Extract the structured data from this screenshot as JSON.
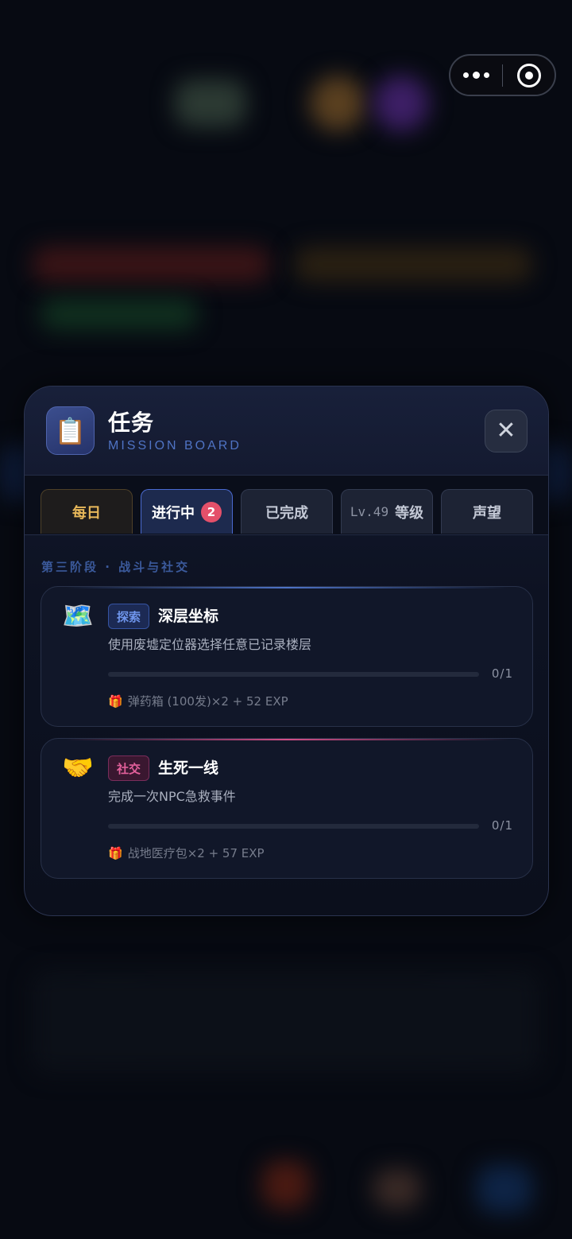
{
  "capsule": {
    "more_icon": "more-dots-icon",
    "close_icon": "target-close-icon"
  },
  "header": {
    "icon": "📋",
    "title": "任务",
    "subtitle": "MISSION BOARD",
    "close_symbol": "✕"
  },
  "tabs": [
    {
      "label": "每日"
    },
    {
      "label": "进行中",
      "badge": "2"
    },
    {
      "label": "已完成"
    },
    {
      "level_prefix": "Lv.49",
      "label": "等级"
    },
    {
      "label": "声望"
    }
  ],
  "stage_label": "第三阶段 · 战斗与社交",
  "missions": [
    {
      "icon": "🗺️",
      "tag": "探索",
      "title": "深层坐标",
      "description": "使用废墟定位器选择任意已记录楼层",
      "progress_text": "0/1",
      "progress_fraction": 0,
      "reward_icon": "🎁",
      "reward": "弹药箱 (100发)×2 + 52 EXP"
    },
    {
      "icon": "🤝",
      "tag": "社交",
      "title": "生死一线",
      "description": "完成一次NPC急救事件",
      "progress_text": "0/1",
      "progress_fraction": 0,
      "reward_icon": "🎁",
      "reward": "战地医疗包×2 + 57 EXP"
    }
  ],
  "colors": {
    "accent": "#4e73c7",
    "badge": "#e4506a",
    "daily": "#e8b85a",
    "social": "#e2609b"
  }
}
